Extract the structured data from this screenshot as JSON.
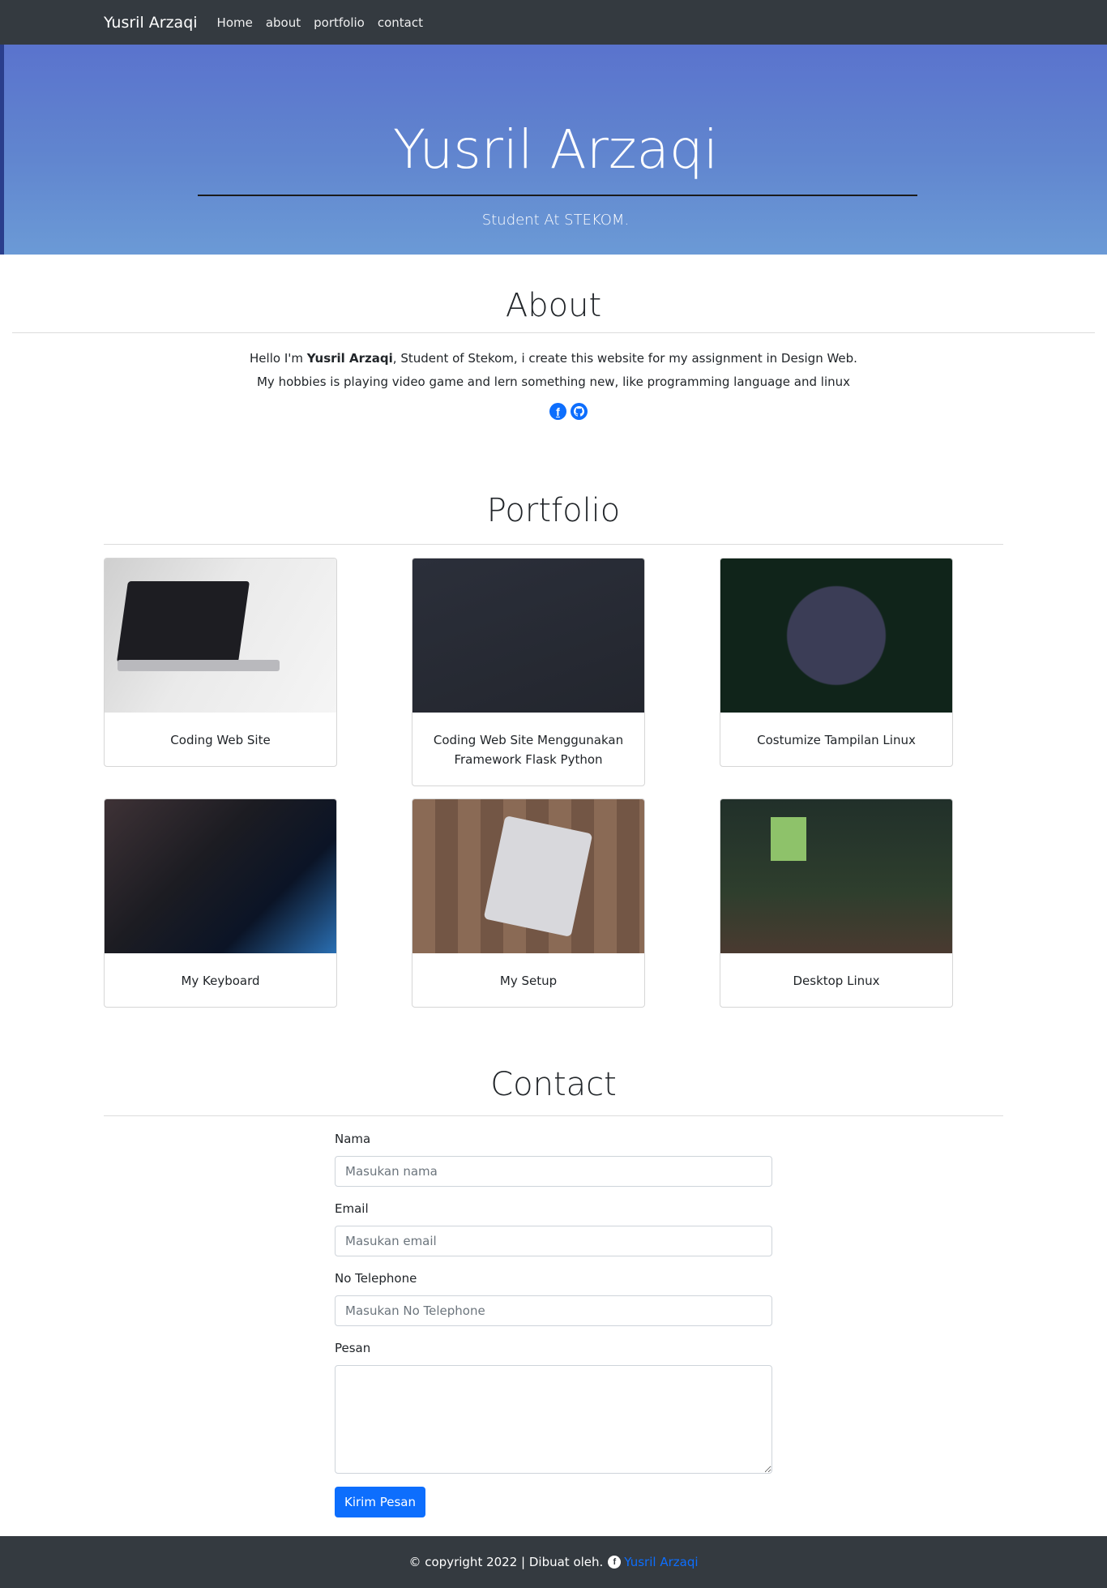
{
  "nav": {
    "brand": "Yusril Arzaqi",
    "links": [
      "Home",
      "about",
      "portfolio",
      "contact"
    ]
  },
  "hero": {
    "title": "Yusril Arzaqi",
    "subtitle": "Student At STEKOM."
  },
  "about": {
    "title": "About",
    "line1_prefix": "Hello I'm ",
    "line1_name": "Yusril Arzaqi",
    "line1_suffix": ", Student of Stekom, i create this website for my assignment in Design Web.",
    "line2": "My hobbies is playing video game and lern something new, like programming language and linux",
    "social_icons": [
      "facebook-icon",
      "github-icon"
    ]
  },
  "portfolio": {
    "title": "Portfolio",
    "items": [
      {
        "caption": "Coding Web Site",
        "image": "laptop-code"
      },
      {
        "caption": "Coding Web Site Menggunakan Framework Flask Python",
        "image": "code-editor"
      },
      {
        "caption": "Costumize Tampilan Linux",
        "image": "linux-jungle"
      },
      {
        "caption": "My Keyboard",
        "image": "keyboard"
      },
      {
        "caption": "My Setup",
        "image": "desk-setup"
      },
      {
        "caption": "Desktop Linux",
        "image": "forest-desktop"
      }
    ]
  },
  "contact": {
    "title": "Contact",
    "name_label": "Nama",
    "name_placeholder": "Masukan nama",
    "email_label": "Email",
    "email_placeholder": "Masukan email",
    "phone_label": "No Telephone",
    "phone_placeholder": "Masukan No Telephone",
    "message_label": "Pesan",
    "submit": "Kirim Pesan"
  },
  "footer": {
    "text": "© copyright 2022 | Dibuat oleh.",
    "author_link": "Yusril Arzaqi"
  },
  "colors": {
    "navbar": "#343a40",
    "accent": "#0d6efd"
  }
}
